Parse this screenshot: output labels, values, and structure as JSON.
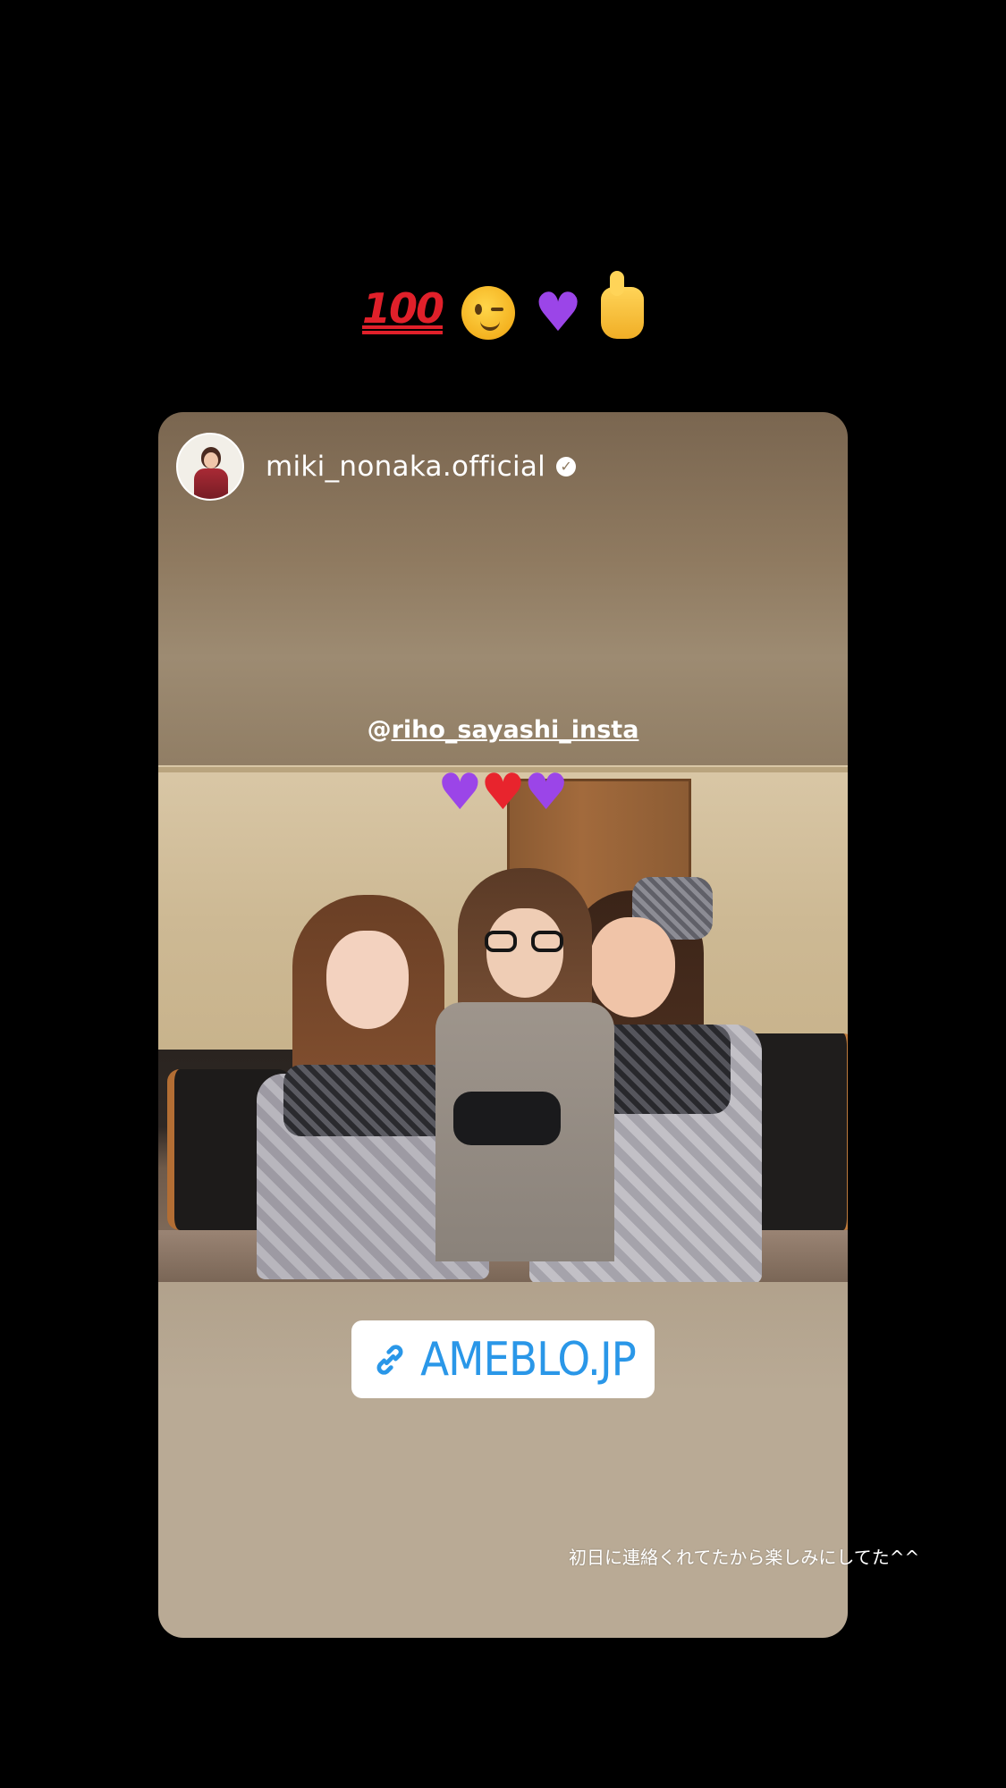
{
  "story": {
    "top_emojis": [
      "hundred-points-emoji",
      "winking-face-emoji",
      "purple-heart-emoji",
      "thumbs-up-emoji"
    ],
    "hundred_text": "100",
    "purple_heart": "♥",
    "shared_post": {
      "username": "miki_nonaka.official",
      "verified_icon": "verified-badge-icon",
      "verified_glyph": "✓",
      "mention_prefix": "@",
      "mention_handle": "riho_sayashi_insta",
      "photo_hearts": {
        "left": "♥",
        "middle": "♥",
        "right": "♥"
      },
      "link_sticker": {
        "icon": "link-icon",
        "label": "AMEBLO.JP"
      }
    },
    "caption": "初日に連絡くれてたから楽しみにしてた^^",
    "colors": {
      "background": "#000000",
      "link_blue": "#2a97e8",
      "purple_heart": "#9b45e8",
      "red_heart": "#e8242d"
    }
  }
}
